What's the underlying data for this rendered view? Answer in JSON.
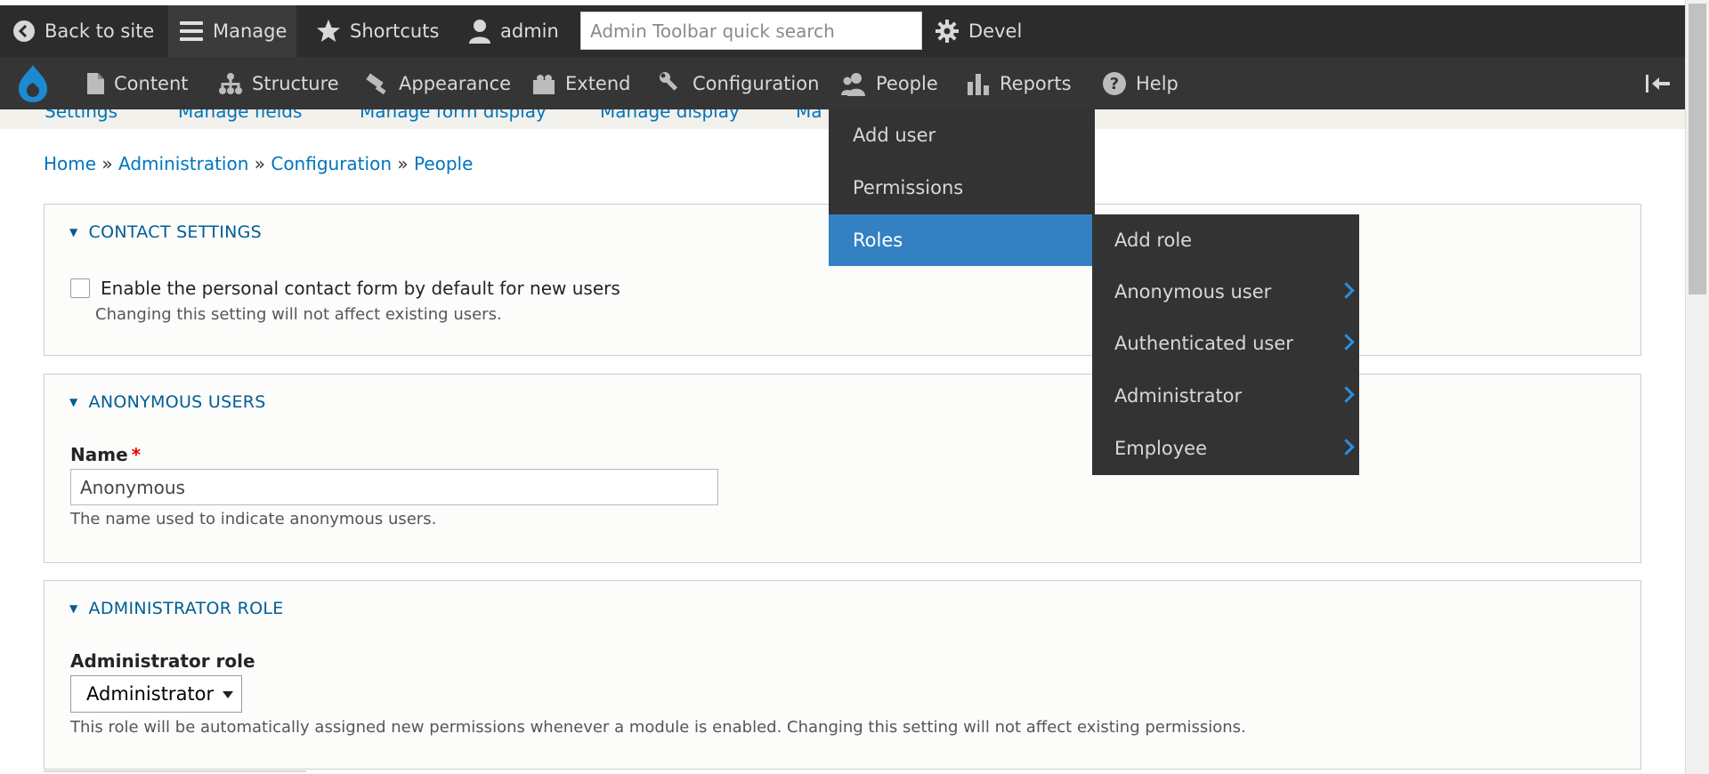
{
  "toolbar": {
    "back_label": "Back to site",
    "manage_label": "Manage",
    "shortcuts_label": "Shortcuts",
    "user_label": "admin",
    "search_placeholder": "Admin Toolbar quick search",
    "devel_label": "Devel"
  },
  "menu": {
    "items": [
      {
        "label": "Content",
        "icon": "file-icon"
      },
      {
        "label": "Structure",
        "icon": "structure-icon"
      },
      {
        "label": "Appearance",
        "icon": "paint-brush-icon"
      },
      {
        "label": "Extend",
        "icon": "puzzle-icon"
      },
      {
        "label": "Configuration",
        "icon": "wrench-icon"
      },
      {
        "label": "People",
        "icon": "people-icon"
      },
      {
        "label": "Reports",
        "icon": "bar-chart-icon"
      },
      {
        "label": "Help",
        "icon": "help-icon"
      }
    ],
    "collapse_icon": "collapse-sidebar-icon"
  },
  "tabs": [
    "Settings",
    "Manage fields",
    "Manage form display",
    "Manage display",
    "Ma"
  ],
  "breadcrumb": {
    "items": [
      "Home",
      "Administration",
      "Configuration",
      "People"
    ],
    "separator": "»"
  },
  "people_dropdown": {
    "items": [
      "Add user",
      "Permissions",
      "Roles"
    ],
    "active": "Roles"
  },
  "roles_submenu": {
    "items": [
      "Add role",
      "Anonymous user",
      "Authenticated user",
      "Administrator",
      "Employee"
    ]
  },
  "contact_settings": {
    "title": "CONTACT SETTINGS",
    "checkbox_label": "Enable the personal contact form by default for new users",
    "description": "Changing this setting will not affect existing users."
  },
  "anonymous_users": {
    "title": "ANONYMOUS USERS",
    "name_label": "Name",
    "required_marker": "*",
    "name_value": "Anonymous",
    "description": "The name used to indicate anonymous users."
  },
  "administrator_role": {
    "title": "ADMINISTRATOR ROLE",
    "field_label": "Administrator role",
    "selected": "Administrator",
    "description": "This role will be automatically assigned new permissions whenever a module is enabled. Changing this setting will not affect existing permissions."
  },
  "colors": {
    "toolbar_bg": "#2c2c2c",
    "menubar_bg": "#353535",
    "link": "#0074bd",
    "active_item": "#3380c3",
    "panel_heading": "#005d96"
  }
}
